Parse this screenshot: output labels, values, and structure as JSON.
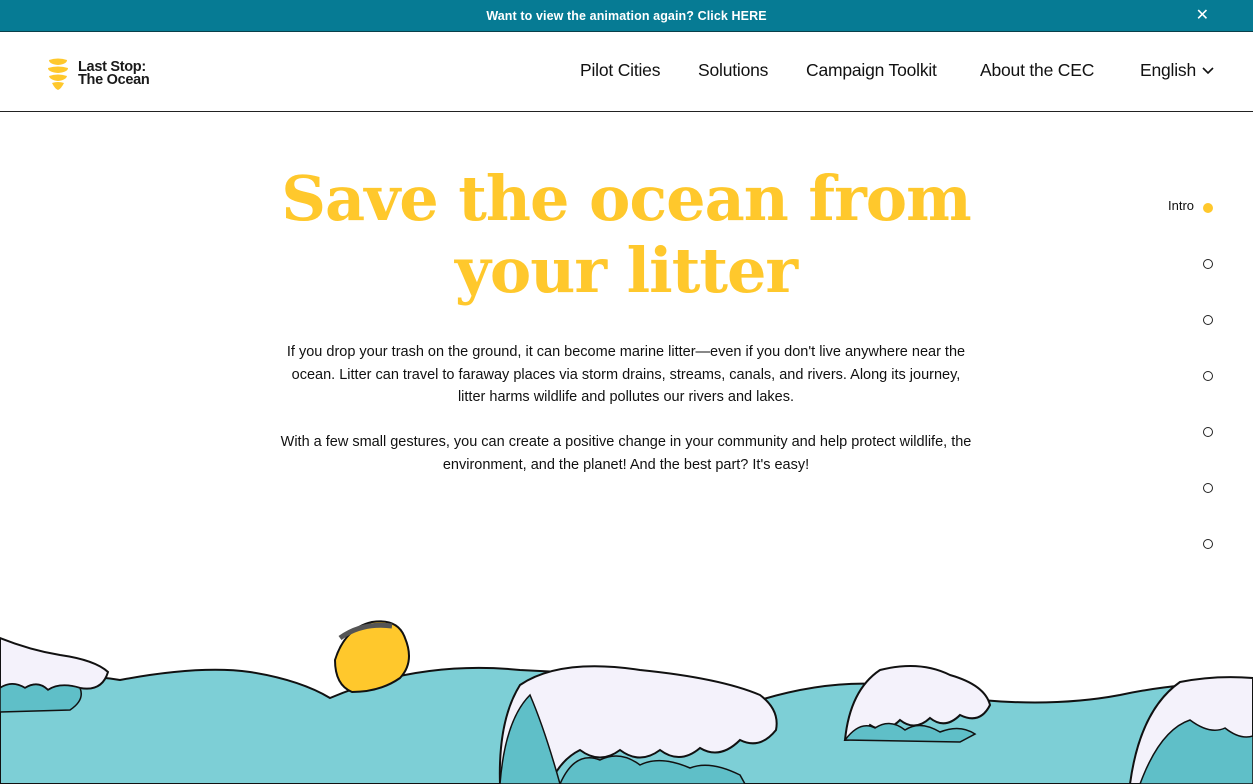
{
  "banner": {
    "text": "Want to view the animation again? Click HERE",
    "close_icon": "close-icon",
    "bg_color": "#067b94"
  },
  "logo": {
    "line1": "Last Stop:",
    "line2": "The Ocean"
  },
  "nav": {
    "pilot_cities": "Pilot Cities",
    "solutions": "Solutions",
    "campaign_toolkit": "Campaign Toolkit",
    "about": "About the CEC",
    "language": "English"
  },
  "hero": {
    "title_line1": "Save the ocean from",
    "title_line2": "your litter",
    "paragraph1": "If you drop your trash on the ground, it can become marine litter—even if you don't live anywhere near the ocean. Litter can travel to faraway places via storm drains, streams, canals, and rivers. Along its journey, litter harms wildlife and pollutes our rivers and lakes.",
    "paragraph2": "With a few small gestures, you can create a positive change in your community and help protect wildlife, the environment, and the planet! And the best part? It's easy!"
  },
  "section_nav": {
    "active_label": "Intro",
    "dot_count": 7,
    "active_index": 0
  },
  "colors": {
    "accent_yellow": "#ffc82c",
    "wave_teal": "#7dcfd6",
    "foam": "#f4f2fb"
  }
}
